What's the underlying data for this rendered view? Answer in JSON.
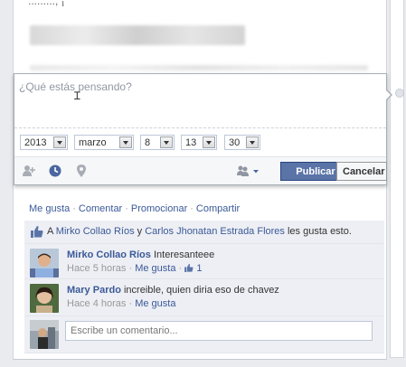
{
  "post": {
    "top_text": "........., ¡",
    "composer": {
      "placeholder": "¿Qué estás pensando?",
      "date": {
        "year": "2013",
        "month": "marzo",
        "day": "8",
        "hour": "13",
        "minute": "30"
      },
      "publish_label": "Publicar",
      "cancel_label": "Cancelar",
      "icons": {
        "tag": "add-friend-icon",
        "time": "clock-icon",
        "place": "location-pin-icon",
        "audience": "friends-audience-icon"
      }
    },
    "actions": {
      "like": "Me gusta",
      "comment": "Comentar",
      "promote": "Promocionar",
      "share": "Compartir",
      "separator": "·"
    },
    "likes": {
      "prefix": "A",
      "person1": "Mirko Collao Ríos",
      "conj": "y",
      "person2": "Carlos Jhonatan Estrada Flores",
      "suffix": "les gusta esto."
    },
    "comments": [
      {
        "author": "Mirko Collao Ríos",
        "text": "Interesanteee",
        "time": "Hace 5 horas",
        "like": "Me gusta",
        "like_count": "1"
      },
      {
        "author": "Mary Pardo",
        "text": "increible, quien diria eso de chavez",
        "time": "Hace 4 horas",
        "like": "Me gusta"
      }
    ],
    "write_placeholder": "Escribe un comentario..."
  }
}
